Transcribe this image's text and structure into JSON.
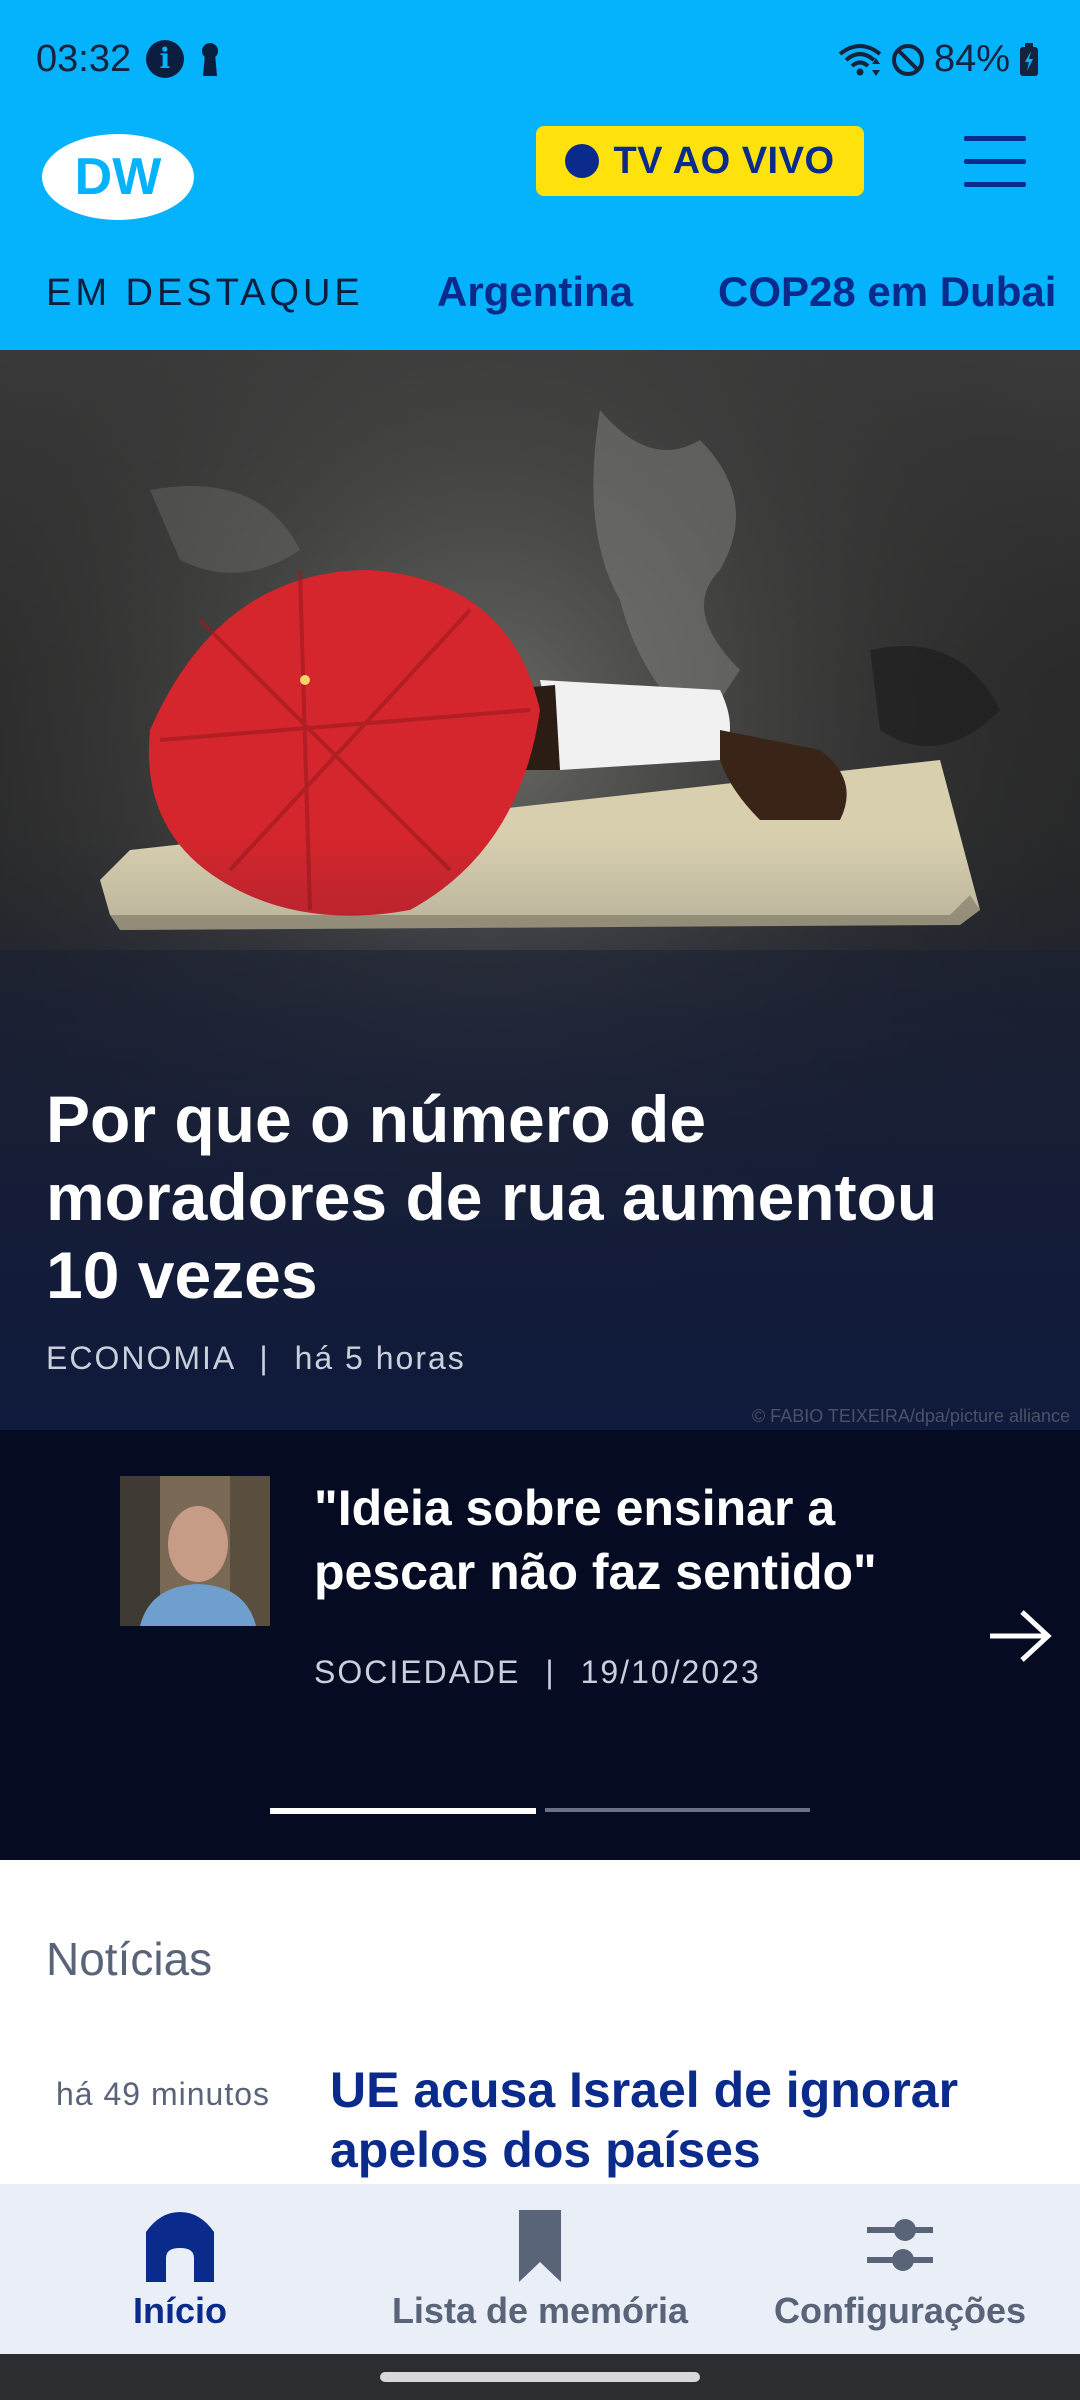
{
  "status_bar": {
    "time": "03:32",
    "battery": "84%"
  },
  "header": {
    "logo_text": "DW",
    "live_button": "TV AO VIVO",
    "highlights_title": "EM DESTAQUE",
    "highlights": [
      "Argentina",
      "COP28 em Dubai"
    ]
  },
  "hero": {
    "title": "Por que o número de moradores de rua aumentou 10 vezes",
    "category": "ECONOMIA",
    "separator": "|",
    "time": "há 5 horas",
    "credit": "© FABIO TEIXEIRA/dpa/picture alliance"
  },
  "carousel": {
    "title": "\"Ideia sobre ensinar a pescar não faz sentido\"",
    "category": "SOCIEDADE",
    "separator": "|",
    "date": "19/10/2023",
    "page_index": 1,
    "page_count": 2
  },
  "news": {
    "heading": "Notícias",
    "items": [
      {
        "time": "há 49 minutos",
        "title": "UE acusa Israel de ignorar apelos dos países"
      }
    ]
  },
  "bottom_nav": {
    "items": [
      {
        "label": "Início",
        "icon": "home-icon",
        "active": true
      },
      {
        "label": "Lista de memória",
        "icon": "bookmark-icon",
        "active": false
      },
      {
        "label": "Configurações",
        "icon": "sliders-icon",
        "active": false
      }
    ]
  },
  "colors": {
    "brand_blue": "#05b2fc",
    "navy": "#0a2a8c",
    "live_yellow": "#ffe20b",
    "carousel_bg": "#050b22",
    "inactive_gray": "#5a6478"
  }
}
